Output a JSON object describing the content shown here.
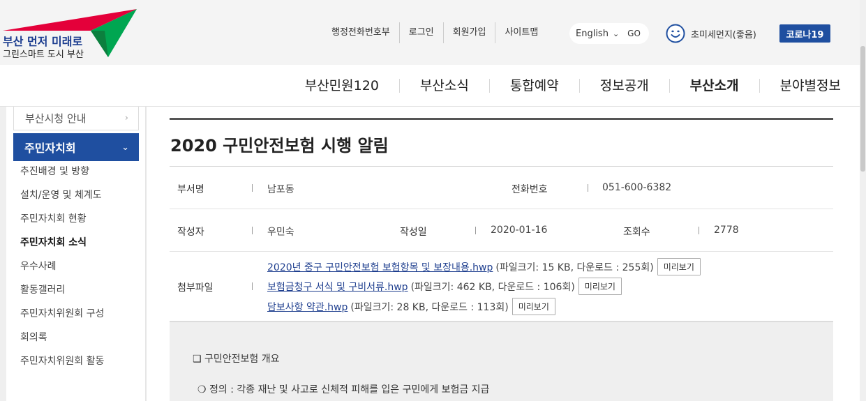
{
  "header": {
    "logo": {
      "line1": "부산 먼저 미래로",
      "line2": "그린스마트 도시 부산"
    },
    "util_links": [
      "행정전화번호부",
      "로그인",
      "회원가입",
      "사이트맵"
    ],
    "language": {
      "selected": "English",
      "go_label": "GO"
    },
    "air_quality": {
      "label": "초미세먼지(좋음)",
      "icon": "smiley-face-icon"
    },
    "corona_button": "코로나19"
  },
  "main_nav": {
    "items": [
      {
        "label": "부산민원120",
        "active": false
      },
      {
        "label": "부산소식",
        "active": false
      },
      {
        "label": "통합예약",
        "active": false
      },
      {
        "label": "정보공개",
        "active": false
      },
      {
        "label": "부산소개",
        "active": true
      },
      {
        "label": "분야별정보",
        "active": false
      }
    ]
  },
  "sidebar": {
    "prev_section": "부산시청 안내",
    "active_section": "주민자치회",
    "sub_items": [
      {
        "label": "추진배경 및 방향",
        "current": false
      },
      {
        "label": "설치/운영 및 체계도",
        "current": false
      },
      {
        "label": "주민자치회 현황",
        "current": false
      },
      {
        "label": "주민자치회 소식",
        "current": true
      },
      {
        "label": "우수사례",
        "current": false
      },
      {
        "label": "활동갤러리",
        "current": false
      },
      {
        "label": "주민자치위원회 구성",
        "current": false
      },
      {
        "label": "회의록",
        "current": false
      },
      {
        "label": "주민자치위원회 활동",
        "current": false
      }
    ]
  },
  "post": {
    "title": "2020 구민안전보험 시행 알림",
    "department_label": "부서명",
    "department": "남포동",
    "phone_label": "전화번호",
    "phone": "051-600-6382",
    "author_label": "작성자",
    "author": "우민숙",
    "date_label": "작성일",
    "date": "2020-01-16",
    "views_label": "조회수",
    "views": "2778",
    "attachments_label": "첨부파일",
    "preview_label": "미리보기",
    "attachments": [
      {
        "name": "2020년 중구 구민안전보험 보험항목 및 보장내용.hwp",
        "meta": "(파일크기: 15 KB, 다운로드 : 255회)"
      },
      {
        "name": "보험금청구 서식 및 구비서류.hwp",
        "meta": "(파일크기: 462 KB, 다운로드 : 106회)"
      },
      {
        "name": "담보사항 약관.hwp",
        "meta": "(파일크기: 28 KB, 다운로드 : 113회)"
      }
    ],
    "body": {
      "heading": "❑ 구민안전보험 개요",
      "definition": "❍ 정의 : 각종 재난 및 사고로 신체적 피해를 입은 구민에게 보험금 지급"
    }
  },
  "colors": {
    "brand_blue": "#1f4fa0",
    "logo_red": "#e4003a",
    "logo_green": "#00a651",
    "link_blue": "#1f3f8f"
  }
}
